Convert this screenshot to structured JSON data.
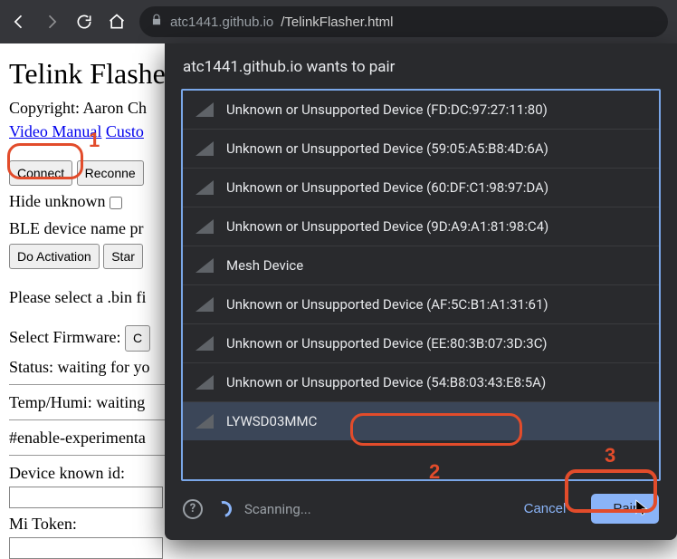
{
  "chrome": {
    "url_host": "atc1441.github.io",
    "url_path": "/TelinkFlasher.html"
  },
  "page": {
    "title": "Telink Flasher",
    "copyright": "Copyright: Aaron Ch",
    "link_video": "Video Manual",
    "link_custom": "Custo",
    "btn_connect": "Connect",
    "btn_reconnect": "Reconne",
    "hide_unknown_label": "Hide unknown",
    "ble_prefix_label": "BLE device name pr",
    "btn_activation": "Do Activation",
    "btn_start": "Star",
    "select_bin": "Please select a .bin fi",
    "select_fw_label": "Select Firmware:",
    "btn_choose": "C",
    "status_label": "Status: waiting for yo",
    "temp_label": "Temp/Humi: waiting",
    "experimental": "#enable-experimenta",
    "device_known": "Device known id:",
    "mi_token": "Mi Token:"
  },
  "dialog": {
    "title": "atc1441.github.io wants to pair",
    "devices": [
      {
        "label": "Unknown or Unsupported Device (FD:DC:97:27:11:80)",
        "selected": false
      },
      {
        "label": "Unknown or Unsupported Device (59:05:A5:B8:4D:6A)",
        "selected": false
      },
      {
        "label": "Unknown or Unsupported Device (60:DF:C1:98:97:DA)",
        "selected": false
      },
      {
        "label": "Unknown or Unsupported Device (9D:A9:A1:81:98:C4)",
        "selected": false
      },
      {
        "label": "Mesh Device",
        "selected": false
      },
      {
        "label": "Unknown or Unsupported Device (AF:5C:B1:A1:31:61)",
        "selected": false
      },
      {
        "label": "Unknown or Unsupported Device (EE:80:3B:07:3D:3C)",
        "selected": false
      },
      {
        "label": "Unknown or Unsupported Device (54:B8:03:43:E8:5A)",
        "selected": false
      },
      {
        "label": "LYWSD03MMC",
        "selected": true
      }
    ],
    "scanning": "Scanning...",
    "cancel": "Cancel",
    "pair": "Pair"
  },
  "annotations": {
    "n1": "1",
    "n2": "2",
    "n3": "3"
  }
}
